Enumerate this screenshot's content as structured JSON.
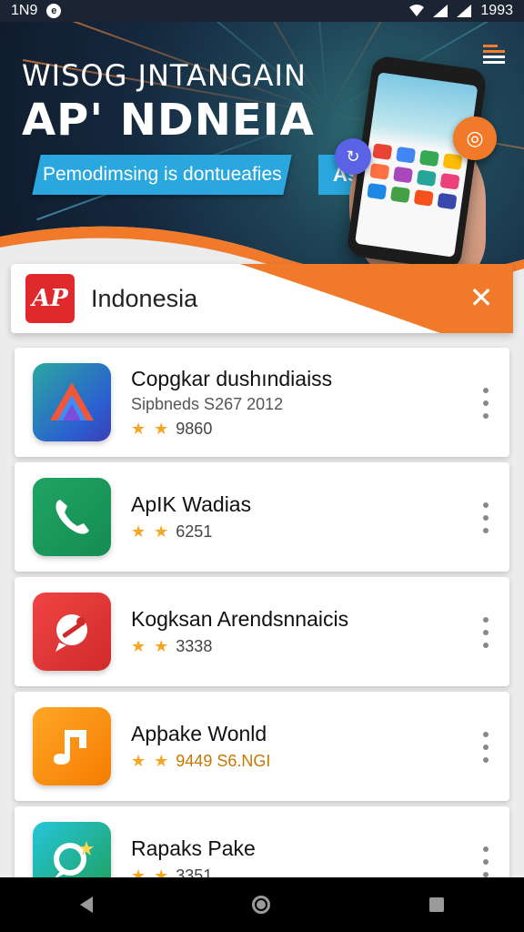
{
  "status_bar": {
    "left_text": "1N9",
    "left_icon": "circle-logo-icon",
    "right_text": "1993",
    "icons": [
      "wifi-icon",
      "signal-icon",
      "signal-icon",
      "battery-icon"
    ]
  },
  "hero": {
    "line1": "WISOG JNTANGAIN",
    "line2": "AP' NDNEIA",
    "pill_text": "Pemodimsing is dontueafies",
    "pill2_text": "As",
    "menu_icon": "menu-icon",
    "bubble_left_icon": "refresh-icon",
    "bubble_right_icon": "chat-icon"
  },
  "header": {
    "logo_text": "AP",
    "title": "Indonesia",
    "close_icon": "close-icon",
    "accent": "#f07a2a"
  },
  "apps": [
    {
      "name": "Copgkar dushındiaiss",
      "sub": "Sipbneds S267 2012",
      "stars": "★ ★",
      "rating": "9860",
      "icon": "triangle-app-icon"
    },
    {
      "name": "ApIK Wadias",
      "sub": "",
      "stars": "★ ★",
      "rating": "6251",
      "icon": "phone-app-icon"
    },
    {
      "name": "Kogksan Arendsnnaicis",
      "sub": "",
      "stars": "★ ★",
      "rating": "3338",
      "icon": "pin-app-icon"
    },
    {
      "name": "Apþake Wonld",
      "sub": "",
      "stars": "★ ★",
      "rating": "9449 S6.NGI",
      "icon": "music-app-icon"
    },
    {
      "name": "Rapaks Pake",
      "sub": "",
      "stars": "★ ★",
      "rating": "3351",
      "icon": "search-app-icon"
    }
  ],
  "nav": {
    "back_icon": "back-icon",
    "home_icon": "home-icon",
    "recents_icon": "recents-icon"
  }
}
